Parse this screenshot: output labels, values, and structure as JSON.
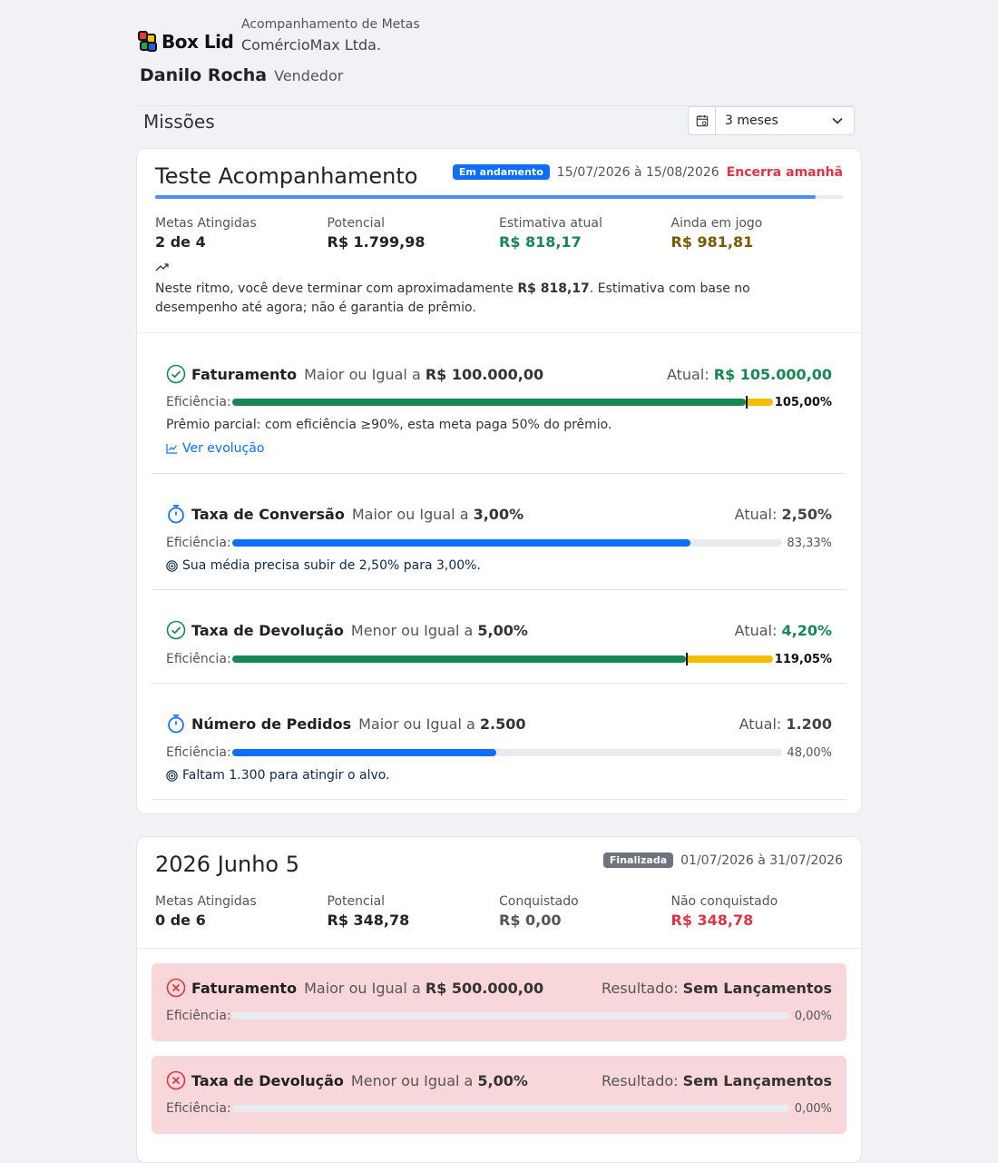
{
  "brand": {
    "name": "Box Lid"
  },
  "header": {
    "subtitle": "Acompanhamento de Metas",
    "company": "ComércioMax Ltda."
  },
  "user": {
    "name": "Danilo Rocha",
    "role": "Vendedor"
  },
  "section": {
    "title": "Missões",
    "period": "3 meses"
  },
  "missions": [
    {
      "title": "Teste Acompanhamento",
      "status": "Em andamento",
      "dates": "15/07/2026 à 15/08/2026",
      "ends": "Encerra amanhã",
      "progress": 0.96,
      "stats": [
        {
          "label": "Metas Atingidas",
          "value": "2 de 4"
        },
        {
          "label": "Potencial",
          "value": "R$ 1.799,98"
        },
        {
          "label": "Estimativa atual",
          "value": "R$ 818,17"
        },
        {
          "label": "Ainda em jogo",
          "value": "R$ 981,81"
        }
      ],
      "note_pre": "Neste ritmo, você deve terminar com aproximadamente ",
      "note_value": "R$ 818,17",
      "note_post": ". Estimativa com base no desempenho até agora; não é garantia de prêmio.",
      "goals": [
        {
          "name": "Faturamento",
          "cond_pre": "Maior ou Igual a ",
          "cond_value": "R$ 100.000,00",
          "current_label": "Atual: ",
          "current": "R$ 105.000,00",
          "eff_label": "Eficiência:",
          "efficiency_pct": 105.0,
          "efficiency": "105,00%",
          "info": "Prêmio parcial: com eficiência ≥90%, esta meta paga 50% do prêmio.",
          "link": "Ver evolução"
        },
        {
          "name": "Taxa de Conversão",
          "cond_pre": "Maior ou Igual a ",
          "cond_value": "3,00%",
          "current_label": "Atual: ",
          "current": "2,50%",
          "eff_label": "Eficiência:",
          "efficiency_pct": 83.33,
          "efficiency": "83,33%",
          "hint": "Sua média precisa subir de 2,50% para 3,00%."
        },
        {
          "name": "Taxa de Devolução",
          "cond_pre": "Menor ou Igual a ",
          "cond_value": "5,00%",
          "current_label": "Atual: ",
          "current": "4,20%",
          "eff_label": "Eficiência:",
          "efficiency_pct": 119.05,
          "efficiency": "119,05%"
        },
        {
          "name": "Número de Pedidos",
          "cond_pre": "Maior ou Igual a ",
          "cond_value": "2.500",
          "current_label": "Atual: ",
          "current": "1.200",
          "eff_label": "Eficiência:",
          "efficiency_pct": 48.0,
          "efficiency": "48,00%",
          "hint": "Faltam 1.300 para atingir o alvo."
        }
      ]
    },
    {
      "title": "2026 Junho 5",
      "status": "Finalizada",
      "dates": "01/07/2026 à 31/07/2026",
      "stats": [
        {
          "label": "Metas Atingidas",
          "value": "0 de 6"
        },
        {
          "label": "Potencial",
          "value": "R$ 348,78"
        },
        {
          "label": "Conquistado",
          "value": "R$ 0,00"
        },
        {
          "label": "Não conquistado",
          "value": "R$ 348,78"
        }
      ],
      "goals": [
        {
          "name": "Faturamento",
          "cond_pre": "Maior ou Igual a ",
          "cond_value": "R$ 500.000,00",
          "current_label": "Resultado: ",
          "current": "Sem Lançamentos",
          "eff_label": "Eficiência:",
          "efficiency_pct": 0,
          "efficiency": "0,00%"
        },
        {
          "name": "Taxa de Devolução",
          "cond_pre": "Menor ou Igual a ",
          "cond_value": "5,00%",
          "current_label": "Resultado: ",
          "current": "Sem Lançamentos",
          "eff_label": "Eficiência:",
          "efficiency_pct": 0,
          "efficiency": "0,00%"
        }
      ]
    }
  ],
  "colors": {
    "success": "#198754",
    "primary": "#0d6efd",
    "danger": "#dc3545",
    "warning": "#f5bd00",
    "fail_bg": "#f8d7da"
  }
}
